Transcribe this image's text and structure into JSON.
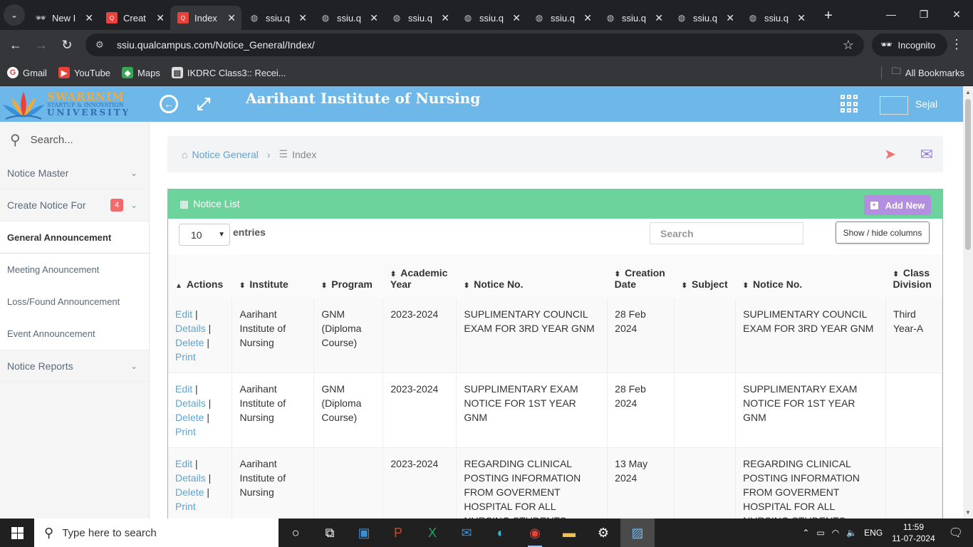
{
  "browser": {
    "tabs": [
      {
        "label": "New I",
        "icon": "incognito-icon"
      },
      {
        "label": "Creat",
        "icon": "qualcampus-icon"
      },
      {
        "label": "Index",
        "icon": "qualcampus-icon",
        "active": true
      },
      {
        "label": "ssiu.q",
        "icon": "globe-icon"
      },
      {
        "label": "ssiu.q",
        "icon": "globe-icon"
      },
      {
        "label": "ssiu.q",
        "icon": "globe-icon"
      },
      {
        "label": "ssiu.q",
        "icon": "globe-icon"
      },
      {
        "label": "ssiu.q",
        "icon": "globe-icon"
      },
      {
        "label": "ssiu.q",
        "icon": "globe-icon"
      },
      {
        "label": "ssiu.q",
        "icon": "globe-icon"
      },
      {
        "label": "ssiu.q",
        "icon": "globe-icon"
      }
    ],
    "url": "ssiu.qualcampus.com/Notice_General/Index/",
    "incognito_label": "Incognito",
    "bookmarks": [
      {
        "label": "Gmail",
        "icon": "gmail-icon"
      },
      {
        "label": "YouTube",
        "icon": "youtube-icon"
      },
      {
        "label": "Maps",
        "icon": "maps-icon"
      },
      {
        "label": "IKDRC Class3:: Recei...",
        "icon": "ikdrc-icon"
      }
    ],
    "all_bookmarks": "All Bookmarks"
  },
  "header": {
    "logo": {
      "line1": "SWARRNIM",
      "line2": "STARTUP & INNOVATION",
      "line3": "UNIVERSITY"
    },
    "title": "Aarihant Institute of Nursing",
    "user": "Sejal"
  },
  "sidebar": {
    "search_placeholder": "Search...",
    "items": [
      {
        "label": "Notice Master"
      },
      {
        "label": "Create Notice For",
        "badge": "4"
      }
    ],
    "subitems": [
      {
        "label": "General Announcement",
        "active": true
      },
      {
        "label": "Meeting Anouncement"
      },
      {
        "label": "Loss/Found Announcement"
      },
      {
        "label": "Event Announcement"
      }
    ],
    "reports": "Notice Reports"
  },
  "breadcrumb": {
    "item1": "Notice General",
    "item2": "Index"
  },
  "panel": {
    "title": "Notice List",
    "add_new": "Add New",
    "entries_value": "10",
    "entries_label": "entries",
    "search_placeholder": "Search",
    "show_hide": "Show / hide columns"
  },
  "table": {
    "headers": [
      "Actions",
      "Institute",
      "Program",
      "Academic Year",
      "Notice No.",
      "Creation Date",
      "Subject",
      "Notice No.",
      "Class Division"
    ],
    "action_links": [
      "Edit",
      "Details",
      "Delete",
      "Print"
    ],
    "rows": [
      {
        "institute": "Aarihant Institute of Nursing",
        "program": "GNM (Diploma Course)",
        "year": "2023-2024",
        "notice": "SUPLIMENTARY COUNCIL EXAM FOR 3RD YEAR GNM",
        "date": "28 Feb 2024",
        "subject": "",
        "notice2": "SUPLIMENTARY COUNCIL EXAM FOR 3RD YEAR GNM",
        "division": "Third Year-A"
      },
      {
        "institute": "Aarihant Institute of Nursing",
        "program": "GNM (Diploma Course)",
        "year": "2023-2024",
        "notice": "SUPPLIMENTARY EXAM NOTICE FOR 1ST YEAR GNM",
        "date": "28 Feb 2024",
        "subject": "",
        "notice2": "SUPPLIMENTARY EXAM NOTICE FOR 1ST YEAR GNM",
        "division": ""
      },
      {
        "institute": "Aarihant Institute of Nursing",
        "program": "",
        "year": "2023-2024",
        "notice": "REGARDING CLINICAL POSTING INFORMATION FROM GOVERMENT HOSPITAL FOR ALL NURSING STUDENTS",
        "date": "13 May 2024",
        "subject": "",
        "notice2": "REGARDING CLINICAL POSTING INFORMATION FROM GOVERMENT HOSPITAL FOR ALL NURSING STUDENTS",
        "division": ""
      }
    ]
  },
  "taskbar": {
    "search_placeholder": "Type here to search",
    "lang": "ENG",
    "time": "11:59",
    "date": "11-07-2024"
  }
}
